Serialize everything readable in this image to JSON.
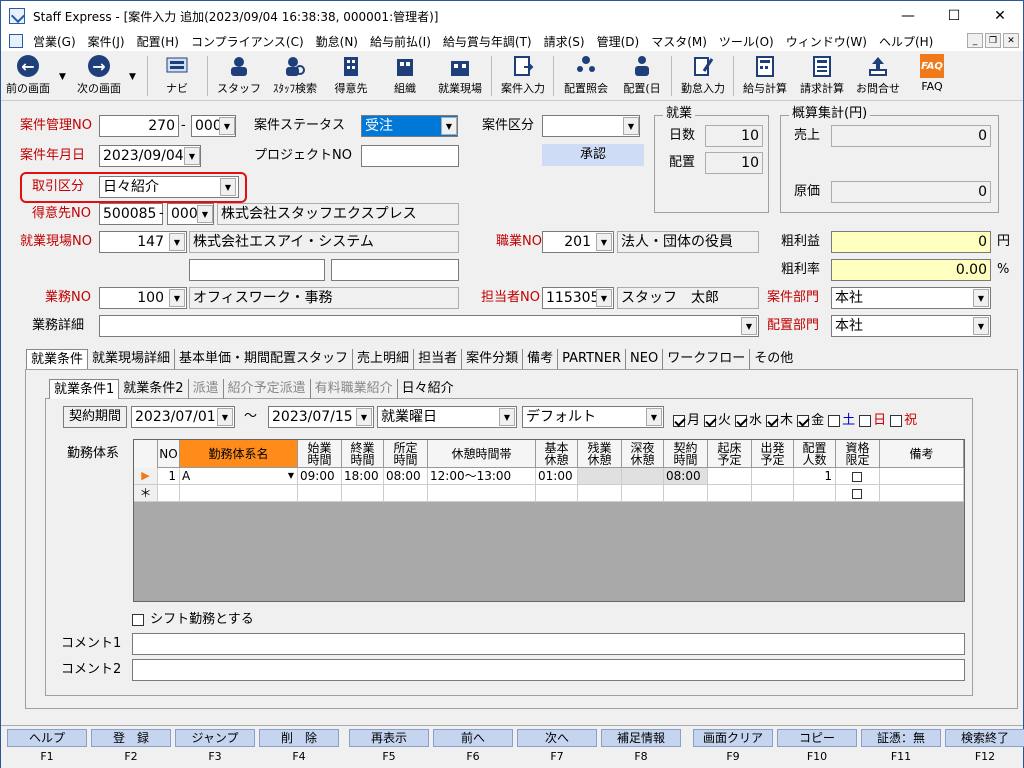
{
  "window": {
    "title": "Staff Express - [案件入力 追加(2023/09/04 16:38:38, 000001:管理者)]",
    "minimize": "—",
    "maximize": "☐",
    "close": "✕"
  },
  "menu": [
    "営業(G)",
    "案件(J)",
    "配置(H)",
    "コンプライアンス(C)",
    "勤怠(N)",
    "給与前払(I)",
    "給与賞与年調(T)",
    "請求(S)",
    "管理(D)",
    "マスタ(M)",
    "ツール(O)",
    "ウィンドウ(W)",
    "ヘルプ(H)"
  ],
  "toolbar": [
    "前の画面",
    "次の画面",
    "ナビ",
    "スタッフ",
    "ｽﾀｯﾌ検索",
    "得意先",
    "組織",
    "就業現場",
    "案件入力",
    "配置照会",
    "配置(日",
    "勤怠入力",
    "給与計算",
    "請求計算",
    "お問合せ",
    "FAQ"
  ],
  "form": {
    "kanri_no_label": "案件管理NO",
    "kanri_no": "270",
    "kanri_sub": "000",
    "status_label": "案件ステータス",
    "status": "受注",
    "kubun_label": "案件区分",
    "kubun": "",
    "approve_btn": "承認",
    "date_label": "案件年月日",
    "date": "2023/09/04",
    "project_label": "プロジェクトNO",
    "project": "",
    "torihiki_label": "取引区分",
    "torihiki": "日々紹介",
    "tokui_label": "得意先NO",
    "tokui_no": "500085",
    "tokui_sub": "000",
    "tokui_name": "株式会社スタッフエクスプレス",
    "genba_label": "就業現場NO",
    "genba_no": "147",
    "genba_name": "株式会社エスアイ・システム",
    "shokugyo_label": "職業NO",
    "shokugyo_no": "201",
    "shokugyo_name": "法人・団体の役員",
    "gyomu_label": "業務NO",
    "gyomu_no": "100",
    "gyomu_name": "オフィスワーク・事務",
    "tanto_label": "担当者NO",
    "tanto_no": "115305",
    "tanto_name": "スタッフ　太郎",
    "bumon_label": "案件部門",
    "bumon": "本社",
    "haichi_bumon_label": "配置部門",
    "haichi_bumon": "本社",
    "shosai_label": "業務詳細",
    "shosai": "",
    "shugyo_title": "就業",
    "nissu_label": "日数",
    "nissu": "10",
    "haichi_label": "配置",
    "haichi": "10",
    "gaisan_title": "概算集計(円)",
    "uriage_label": "売上",
    "uriage": "0",
    "genka_label": "原価",
    "genka": "0",
    "arari_label": "粗利益",
    "arari": "0",
    "arari_unit": "円",
    "ararit_label": "粗利率",
    "ararit": "0.00",
    "ararit_unit": "%"
  },
  "tabs": [
    "就業条件",
    "就業現場詳細",
    "基本単価・期間配置スタッフ",
    "売上明細",
    "担当者",
    "案件分類",
    "備考",
    "PARTNER",
    "NEO",
    "ワークフロー",
    "その他"
  ],
  "subtabs": [
    "就業条件1",
    "就業条件2",
    "派遣",
    "紹介予定派遣",
    "有料職業紹介",
    "日々紹介"
  ],
  "cond": {
    "period_btn": "契約期間",
    "from": "2023/07/01",
    "tilde": "～",
    "to": "2023/07/15",
    "youbi": "就業曜日",
    "default": "デフォルト",
    "days": [
      {
        "label": "月",
        "on": true,
        "color": "#000"
      },
      {
        "label": "火",
        "on": true,
        "color": "#000"
      },
      {
        "label": "水",
        "on": true,
        "color": "#000"
      },
      {
        "label": "木",
        "on": true,
        "color": "#000"
      },
      {
        "label": "金",
        "on": true,
        "color": "#000"
      },
      {
        "label": "土",
        "on": false,
        "color": "#0000cc"
      },
      {
        "label": "日",
        "on": false,
        "color": "#cc0000"
      },
      {
        "label": "祝",
        "on": false,
        "color": "#cc0000"
      }
    ],
    "kinmu_label": "勤務体系",
    "shift_label": "シフト勤務とする",
    "comment1_label": "コメント1",
    "comment2_label": "コメント2"
  },
  "grid": {
    "headers": [
      "NO",
      "勤務体系名",
      "始業\n時間",
      "終業\n時間",
      "所定\n時間",
      "休憩時間帯",
      "基本\n休憩",
      "残業\n休憩",
      "深夜\n休憩",
      "契約\n時間",
      "起床\n予定",
      "出発\n予定",
      "配置\n人数",
      "資格\n限定",
      "備考"
    ],
    "row": {
      "no": "1",
      "name": "A",
      "start": "09:00",
      "end": "18:00",
      "shotei": "08:00",
      "kyukei": "12:00～13:00",
      "kihon": "01:00",
      "keiyaku": "08:00",
      "ninzu": "1"
    },
    "new_row_marker": "＊"
  },
  "fkeys": [
    {
      "label": "ヘルプ",
      "key": "F1"
    },
    {
      "label": "登　録",
      "key": "F2"
    },
    {
      "label": "ジャンプ",
      "key": "F3"
    },
    {
      "label": "削　除",
      "key": "F4"
    },
    {
      "label": "再表示",
      "key": "F5"
    },
    {
      "label": "前へ",
      "key": "F6"
    },
    {
      "label": "次へ",
      "key": "F7"
    },
    {
      "label": "補足情報",
      "key": "F8"
    },
    {
      "label": "画面クリア",
      "key": "F9"
    },
    {
      "label": "コピー",
      "key": "F10"
    },
    {
      "label": "証憑：無",
      "key": "F11"
    },
    {
      "label": "検索終了",
      "key": "F12"
    }
  ]
}
